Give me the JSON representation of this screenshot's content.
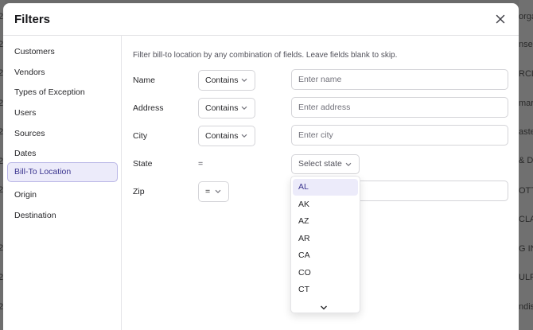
{
  "background": {
    "left_fragments": [
      "2",
      "2",
      "2",
      "2",
      "2",
      "2",
      "2",
      "2",
      "2",
      "2"
    ],
    "right_fragments": [
      "orga",
      "nsem",
      "RCL",
      "marte",
      "aster",
      "& D T",
      "OTT ",
      "CLAS",
      "G IN",
      "ULFE",
      "ndiso"
    ]
  },
  "modal": {
    "title": "Filters"
  },
  "sidebar": {
    "items": [
      {
        "label": "Customers"
      },
      {
        "label": "Vendors"
      },
      {
        "label": "Types of Exception"
      },
      {
        "label": "Users"
      },
      {
        "label": "Sources"
      },
      {
        "label": "Dates"
      },
      {
        "label": "Bill-To Location",
        "active": true
      },
      {
        "label": "Origin"
      },
      {
        "label": "Destination"
      }
    ]
  },
  "content": {
    "description": "Filter bill-to location by any combination of fields. Leave fields blank to skip.",
    "fields": {
      "name": {
        "label": "Name",
        "operator": "Contains",
        "placeholder": "Enter name",
        "value": ""
      },
      "address": {
        "label": "Address",
        "operator": "Contains",
        "placeholder": "Enter address",
        "value": ""
      },
      "city": {
        "label": "City",
        "operator": "Contains",
        "placeholder": "Enter city",
        "value": ""
      },
      "state": {
        "label": "State",
        "operator": "=",
        "placeholder": "Select state"
      },
      "zip": {
        "label": "Zip",
        "operator": "=",
        "placeholder": "",
        "value": ""
      }
    },
    "state_dropdown": {
      "options": [
        "AL",
        "AK",
        "AZ",
        "AR",
        "CA",
        "CO",
        "CT"
      ],
      "highlighted": "AL"
    }
  },
  "icons": {
    "close": "close-icon",
    "chevron": "chevron-down-icon"
  },
  "colors": {
    "accent_bg": "#ecebfa",
    "accent_border": "#b9b6e6",
    "accent_text": "#3b358f"
  }
}
